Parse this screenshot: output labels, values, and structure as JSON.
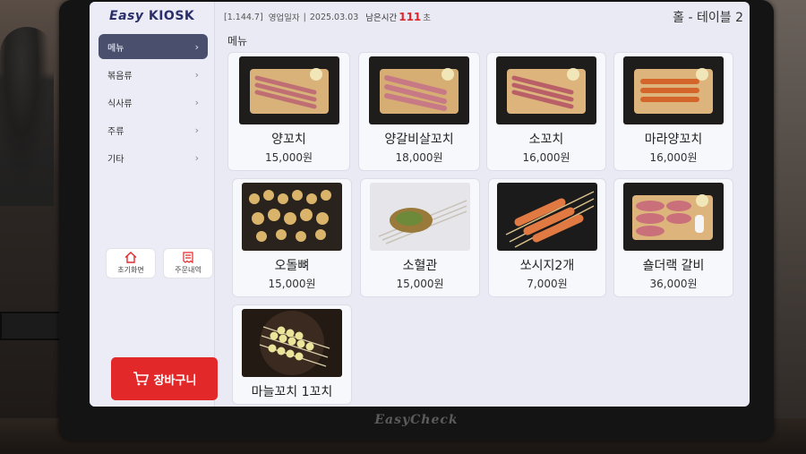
{
  "app": {
    "logo_easy": "Easy",
    "logo_kiosk": "KIOSK",
    "bezel_brand": "EasyCheck"
  },
  "topbar": {
    "version": "[1.144.7]",
    "business_label": "영업일자",
    "business_date": "2025.03.03",
    "remain_label": "남은시간",
    "remain_value": "111",
    "remain_unit": "초",
    "table_label": "홀 - 테이블 2"
  },
  "sidebar": {
    "items": [
      {
        "label": "메뉴",
        "active": true
      },
      {
        "label": "볶음류"
      },
      {
        "label": "식사류"
      },
      {
        "label": "주류"
      },
      {
        "label": "기타"
      }
    ],
    "quick_home": "초기화면",
    "quick_orders": "주문내역",
    "cart": "장바구니"
  },
  "main": {
    "section_title": "메뉴",
    "products": [
      {
        "name": "양꼬치",
        "price": "15,000원"
      },
      {
        "name": "양갈비살꼬치",
        "price": "18,000원"
      },
      {
        "name": "소꼬치",
        "price": "16,000원"
      },
      {
        "name": "마라양꼬치",
        "price": "16,000원"
      },
      {
        "name": "오돌뼈",
        "price": "15,000원"
      },
      {
        "name": "소혈관",
        "price": "15,000원"
      },
      {
        "name": "쏘시지2개",
        "price": "7,000원"
      },
      {
        "name": "숄더랙 갈비",
        "price": "36,000원"
      },
      {
        "name": "마늘꼬치 1꼬치",
        "price": ""
      }
    ]
  },
  "colors": {
    "accent_red": "#e3282a",
    "nav_active": "#4a4f6e",
    "logo": "#2a2f6a"
  }
}
